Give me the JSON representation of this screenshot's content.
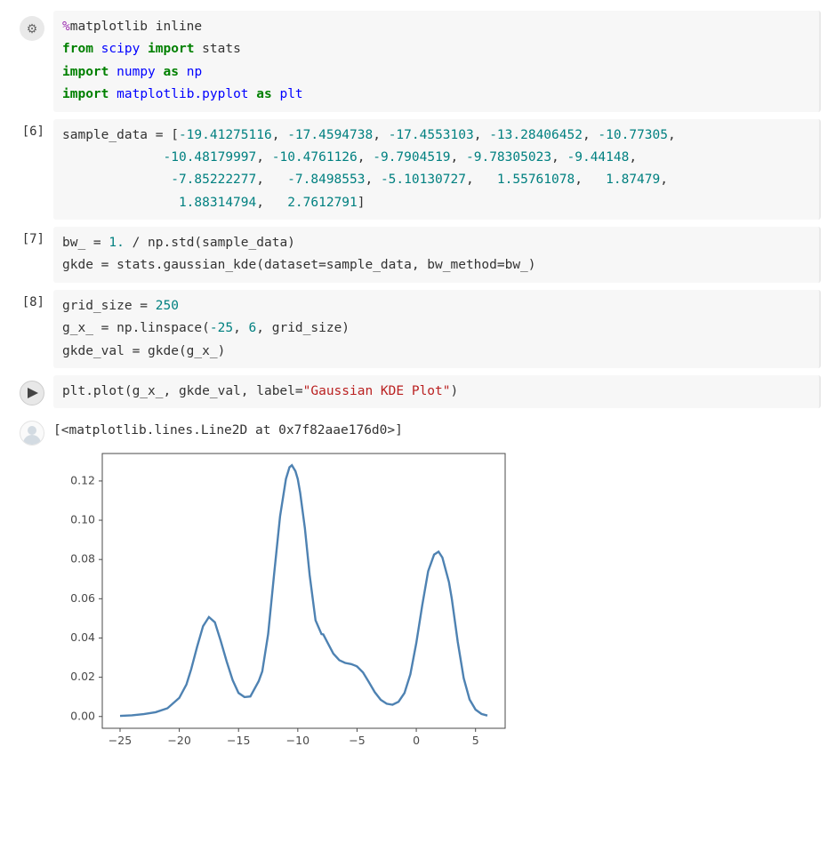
{
  "cells": [
    {
      "kind": "code",
      "gutter_type": "settings",
      "tokens": [
        {
          "cls": "tk-pct",
          "t": "%"
        },
        {
          "cls": "tk-txt",
          "t": "matplotlib inline"
        },
        {
          "cls": "nl"
        },
        {
          "cls": "tk-kw",
          "t": "from"
        },
        {
          "cls": "tk-txt",
          "t": " "
        },
        {
          "cls": "tk-nn",
          "t": "scipy"
        },
        {
          "cls": "tk-txt",
          "t": " "
        },
        {
          "cls": "tk-kw",
          "t": "import"
        },
        {
          "cls": "tk-txt",
          "t": " stats"
        },
        {
          "cls": "nl"
        },
        {
          "cls": "tk-kw",
          "t": "import"
        },
        {
          "cls": "tk-txt",
          "t": " "
        },
        {
          "cls": "tk-nn",
          "t": "numpy"
        },
        {
          "cls": "tk-txt",
          "t": " "
        },
        {
          "cls": "tk-kw",
          "t": "as"
        },
        {
          "cls": "tk-txt",
          "t": " "
        },
        {
          "cls": "tk-nn",
          "t": "np"
        },
        {
          "cls": "nl"
        },
        {
          "cls": "tk-kw",
          "t": "import"
        },
        {
          "cls": "tk-txt",
          "t": " "
        },
        {
          "cls": "tk-nn",
          "t": "matplotlib.pyplot"
        },
        {
          "cls": "tk-txt",
          "t": " "
        },
        {
          "cls": "tk-kw",
          "t": "as"
        },
        {
          "cls": "tk-txt",
          "t": " "
        },
        {
          "cls": "tk-nn",
          "t": "plt"
        }
      ]
    },
    {
      "kind": "code",
      "gutter_type": "prompt",
      "prompt": "[6]",
      "tokens": [
        {
          "cls": "tk-txt",
          "t": "sample_data = ["
        },
        {
          "cls": "tk-num",
          "t": "-19.41275116"
        },
        {
          "cls": "tk-txt",
          "t": ", "
        },
        {
          "cls": "tk-num",
          "t": "-17.4594738"
        },
        {
          "cls": "tk-txt",
          "t": ", "
        },
        {
          "cls": "tk-num",
          "t": "-17.4553103"
        },
        {
          "cls": "tk-txt",
          "t": ", "
        },
        {
          "cls": "tk-num",
          "t": "-13.28406452"
        },
        {
          "cls": "tk-txt",
          "t": ", "
        },
        {
          "cls": "tk-num",
          "t": "-10.77305"
        },
        {
          "cls": "tk-txt",
          "t": ","
        },
        {
          "cls": "nl"
        },
        {
          "cls": "tk-txt",
          "t": "             "
        },
        {
          "cls": "tk-num",
          "t": "-10.48179997"
        },
        {
          "cls": "tk-txt",
          "t": ", "
        },
        {
          "cls": "tk-num",
          "t": "-10.4761126"
        },
        {
          "cls": "tk-txt",
          "t": ", "
        },
        {
          "cls": "tk-num",
          "t": "-9.7904519"
        },
        {
          "cls": "tk-txt",
          "t": ", "
        },
        {
          "cls": "tk-num",
          "t": "-9.78305023"
        },
        {
          "cls": "tk-txt",
          "t": ", "
        },
        {
          "cls": "tk-num",
          "t": "-9.44148"
        },
        {
          "cls": "tk-txt",
          "t": ","
        },
        {
          "cls": "nl"
        },
        {
          "cls": "tk-txt",
          "t": "              "
        },
        {
          "cls": "tk-num",
          "t": "-7.85222277"
        },
        {
          "cls": "tk-txt",
          "t": ",   "
        },
        {
          "cls": "tk-num",
          "t": "-7.8498553"
        },
        {
          "cls": "tk-txt",
          "t": ", "
        },
        {
          "cls": "tk-num",
          "t": "-5.10130727"
        },
        {
          "cls": "tk-txt",
          "t": ",   "
        },
        {
          "cls": "tk-num",
          "t": "1.55761078"
        },
        {
          "cls": "tk-txt",
          "t": ",   "
        },
        {
          "cls": "tk-num",
          "t": "1.87479"
        },
        {
          "cls": "tk-txt",
          "t": ","
        },
        {
          "cls": "nl"
        },
        {
          "cls": "tk-txt",
          "t": "               "
        },
        {
          "cls": "tk-num",
          "t": "1.88314794"
        },
        {
          "cls": "tk-txt",
          "t": ",   "
        },
        {
          "cls": "tk-num",
          "t": "2.7612791"
        },
        {
          "cls": "tk-txt",
          "t": "]"
        }
      ]
    },
    {
      "kind": "code",
      "gutter_type": "prompt",
      "prompt": "[7]",
      "tokens": [
        {
          "cls": "tk-txt",
          "t": "bw_ = "
        },
        {
          "cls": "tk-num",
          "t": "1."
        },
        {
          "cls": "tk-txt",
          "t": " / np.std(sample_data)"
        },
        {
          "cls": "nl"
        },
        {
          "cls": "tk-txt",
          "t": "gkde = stats.gaussian_kde(dataset=sample_data, bw_method=bw_)"
        }
      ]
    },
    {
      "kind": "code",
      "gutter_type": "prompt",
      "prompt": "[8]",
      "tokens": [
        {
          "cls": "tk-txt",
          "t": "grid_size = "
        },
        {
          "cls": "tk-num",
          "t": "250"
        },
        {
          "cls": "nl"
        },
        {
          "cls": "tk-txt",
          "t": "g_x_ = np.linspace("
        },
        {
          "cls": "tk-num",
          "t": "-25"
        },
        {
          "cls": "tk-txt",
          "t": ", "
        },
        {
          "cls": "tk-num",
          "t": "6"
        },
        {
          "cls": "tk-txt",
          "t": ", grid_size)"
        },
        {
          "cls": "nl"
        },
        {
          "cls": "tk-txt",
          "t": "gkde_val = gkde(g_x_)"
        }
      ]
    },
    {
      "kind": "code",
      "gutter_type": "run",
      "tokens": [
        {
          "cls": "tk-txt",
          "t": "plt.plot(g_x_, gkde_val, label="
        },
        {
          "cls": "tk-str",
          "t": "\"Gaussian KDE Plot\""
        },
        {
          "cls": "tk-txt",
          "t": ")"
        }
      ]
    },
    {
      "kind": "output",
      "gutter_type": "avatar",
      "output_text": "[<matplotlib.lines.Line2D at 0x7f82aae176d0>]"
    }
  ],
  "chart_data": {
    "type": "line",
    "title": "",
    "xlabel": "",
    "ylabel": "",
    "xlim": [
      -26.5,
      7.5
    ],
    "ylim": [
      -0.006,
      0.134
    ],
    "x_ticks": [
      -25,
      -20,
      -15,
      -10,
      -5,
      0,
      5
    ],
    "y_ticks": [
      0.0,
      0.02,
      0.04,
      0.06,
      0.08,
      0.1,
      0.12
    ],
    "sample_data": [
      -19.41275116,
      -17.4594738,
      -17.4553103,
      -13.28406452,
      -10.77305,
      -10.48179997,
      -10.4761126,
      -9.7904519,
      -9.78305023,
      -9.44148,
      -7.85222277,
      -7.8498553,
      -5.10130727,
      1.55761078,
      1.87479,
      1.88314794,
      2.7612791
    ],
    "grid_size": 250,
    "grid_x_range": [
      -25,
      6
    ],
    "kde_bandwidth_desc": "1.0 / std(sample_data)",
    "series": [
      {
        "name": "Gaussian KDE Plot",
        "color": "#4e82b2",
        "x": [
          -25,
          -24,
          -23,
          -22,
          -21,
          -20,
          -19.4,
          -19,
          -18.5,
          -18,
          -17.5,
          -17,
          -16.5,
          -16,
          -15.5,
          -15,
          -14.5,
          -14,
          -13.5,
          -13.3,
          -13,
          -12.5,
          -12,
          -11.5,
          -11,
          -10.7,
          -10.5,
          -10.2,
          -10,
          -9.8,
          -9.4,
          -9,
          -8.5,
          -8,
          -7.85,
          -7.5,
          -7,
          -6.5,
          -6,
          -5.5,
          -5.1,
          -5,
          -4.5,
          -4,
          -3.5,
          -3,
          -2.5,
          -2,
          -1.5,
          -1,
          -0.5,
          0,
          0.5,
          1,
          1.5,
          1.88,
          2.2,
          2.76,
          3,
          3.5,
          4,
          4.5,
          5,
          5.5,
          6
        ],
        "y": [
          0.0003,
          0.0006,
          0.0012,
          0.0022,
          0.0042,
          0.0095,
          0.0163,
          0.024,
          0.0355,
          0.046,
          0.0507,
          0.048,
          0.0385,
          0.028,
          0.0185,
          0.012,
          0.0099,
          0.0102,
          0.0158,
          0.018,
          0.023,
          0.042,
          0.0725,
          0.102,
          0.121,
          0.127,
          0.128,
          0.125,
          0.121,
          0.114,
          0.096,
          0.072,
          0.049,
          0.042,
          0.0418,
          0.0378,
          0.032,
          0.0287,
          0.0273,
          0.0267,
          0.0258,
          0.0255,
          0.0225,
          0.0175,
          0.0124,
          0.0085,
          0.0065,
          0.006,
          0.0075,
          0.012,
          0.0215,
          0.0375,
          0.0565,
          0.074,
          0.0825,
          0.084,
          0.081,
          0.0685,
          0.06,
          0.038,
          0.0195,
          0.0087,
          0.0035,
          0.0013,
          0.0005
        ]
      }
    ]
  }
}
